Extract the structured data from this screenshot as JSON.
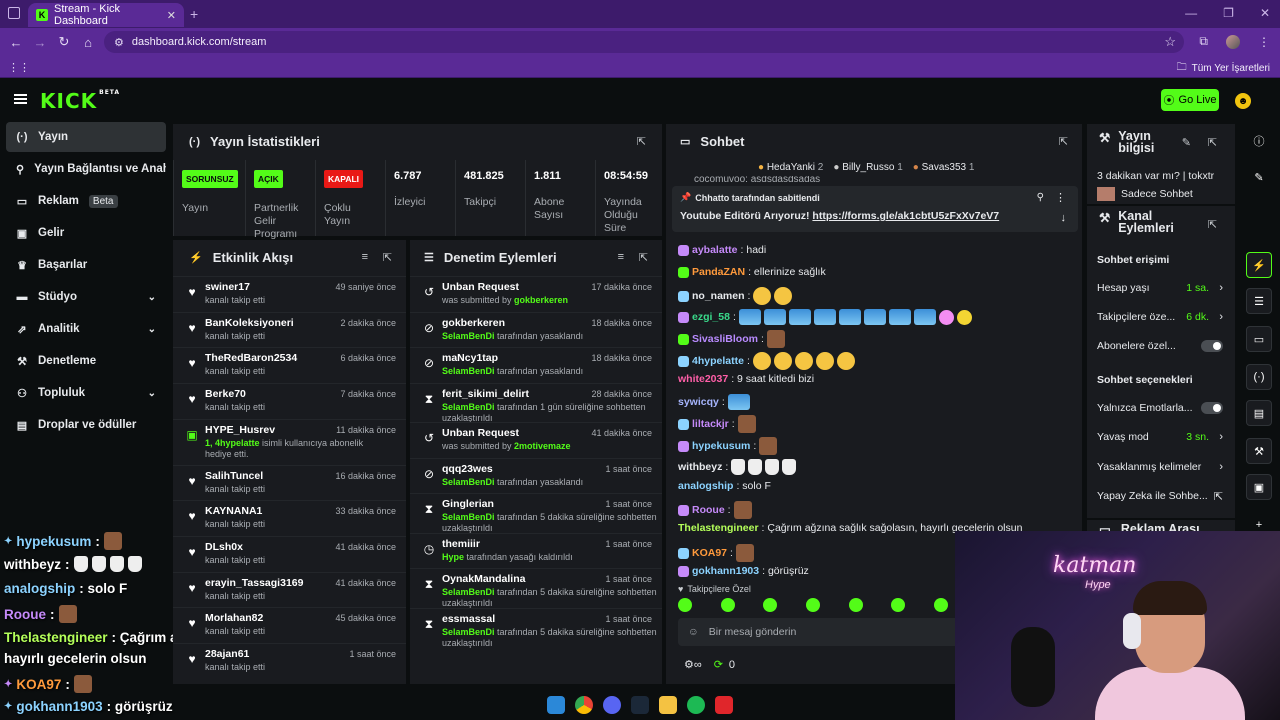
{
  "browser": {
    "tab_title": "Stream - Kick Dashboard",
    "tab_favicon": "K",
    "url": "dashboard.kick.com/stream",
    "bookmarks_label": "Tüm Yer İşaretleri"
  },
  "header": {
    "logo": "KICK",
    "logo_sup": "BETA",
    "go_live": "Go Live"
  },
  "sidebar": {
    "items": [
      {
        "label": "Yayın",
        "icon": "broadcast-icon"
      },
      {
        "label": "Yayın Bağlantısı ve Anahtar",
        "icon": "link-icon"
      },
      {
        "label": "Reklam",
        "icon": "ad-icon",
        "badge": "Beta"
      },
      {
        "label": "Gelir",
        "icon": "revenue-icon"
      },
      {
        "label": "Başarılar",
        "icon": "trophy-icon"
      },
      {
        "label": "Stüdyo",
        "icon": "studio-icon"
      },
      {
        "label": "Analitik",
        "icon": "analytics-icon"
      },
      {
        "label": "Denetleme",
        "icon": "moderation-icon"
      },
      {
        "label": "Topluluk",
        "icon": "community-icon"
      },
      {
        "label": "Droplar ve ödüller",
        "icon": "drops-icon"
      }
    ]
  },
  "stats": {
    "title": "Yayın İstatistikleri",
    "items": [
      {
        "badge": "SORUNSUZ",
        "label": "Yayın"
      },
      {
        "badge": "AÇIK",
        "label": "Partnerlik Gelir Programı"
      },
      {
        "badge": "KAPALI",
        "label": "Çoklu Yayın"
      },
      {
        "value": "6.787",
        "label": "İzleyici"
      },
      {
        "value": "481.825",
        "label": "Takipçi"
      },
      {
        "value": "1.811",
        "label": "Abone Sayısı"
      },
      {
        "value": "08:54:59",
        "label": "Yayında Olduğu Süre"
      }
    ]
  },
  "activity": {
    "title": "Etkinlik Akışı",
    "rows": [
      {
        "name": "swiner17",
        "sub": "kanalı takip etti",
        "time": "49 saniye önce"
      },
      {
        "name": "BanKoleksiyoneri",
        "sub": "kanalı takip etti",
        "time": "2 dakika önce"
      },
      {
        "name": "TheRedBaron2534",
        "sub": "kanalı takip etti",
        "time": "6 dakika önce"
      },
      {
        "name": "Berke70",
        "sub": "kanalı takip etti",
        "time": "7 dakika önce"
      },
      {
        "name": "HYPE_Husrev",
        "sub_green": "1, 4hypelatte",
        "sub": " isimli kullanıcıya abonelik hediye etti.",
        "time": "11 dakika önce"
      },
      {
        "name": "SalihTuncel",
        "sub": "kanalı takip etti",
        "time": "16 dakika önce"
      },
      {
        "name": "KAYNANA1",
        "sub": "kanalı takip etti",
        "time": "33 dakika önce"
      },
      {
        "name": "DLsh0x",
        "sub": "kanalı takip etti",
        "time": "41 dakika önce"
      },
      {
        "name": "erayin_Tassagi3169",
        "sub": "kanalı takip etti",
        "time": "41 dakika önce"
      },
      {
        "name": "Morlahan82",
        "sub": "kanalı takip etti",
        "time": "45 dakika önce"
      },
      {
        "name": "28ajan61",
        "sub": "kanalı takip etti",
        "time": "1 saat önce"
      }
    ]
  },
  "moderation": {
    "title": "Denetim Eylemleri",
    "rows": [
      {
        "name": "Unban Request",
        "pre": "was submitted by ",
        "who": "gokberkeren",
        "post": "",
        "time": "17 dakika önce"
      },
      {
        "name": "gokberkeren",
        "pre": "",
        "who": "SelamBenDi",
        "post": " tarafından yasaklandı",
        "time": "18 dakika önce"
      },
      {
        "name": "maNcy1tap",
        "pre": "",
        "who": "SelamBenDi",
        "post": " tarafından yasaklandı",
        "time": "18 dakika önce"
      },
      {
        "name": "ferit_sikimi_delirt",
        "pre": "",
        "who": "SelamBenDi",
        "post": " tarafından 1 gün süreliğine sohbetten",
        "post2": "uzaklaştırıldı",
        "time": "28 dakika önce"
      },
      {
        "name": "Unban Request",
        "pre": "was submitted by ",
        "who": "2motivemaze",
        "post": "",
        "time": "41 dakika önce"
      },
      {
        "name": "qqq23wes",
        "pre": "",
        "who": "SelamBenDi",
        "post": " tarafından yasaklandı",
        "time": "1 saat önce"
      },
      {
        "name": "Ginglerian",
        "pre": "",
        "who": "SelamBenDi",
        "post": " tarafından 5 dakika süreliğine sohbetten",
        "post2": "uzaklaştırıldı",
        "time": "1 saat önce"
      },
      {
        "name": "themiiir",
        "pre": "",
        "who": "Hype",
        "post": " tarafından yasağı kaldırıldı",
        "time": "1 saat önce"
      },
      {
        "name": "OynakMandalina",
        "pre": "",
        "who": "SelamBenDi",
        "post": " tarafından 5 dakika süreliğine sohbetten",
        "post2": "uzaklaştırıldı",
        "time": "1 saat önce"
      },
      {
        "name": "essmassal",
        "pre": "",
        "who": "SelamBenDi",
        "post": " tarafından 5 dakika süreliğine sohbetten",
        "post2": "uzaklaştırıldı",
        "time": "1 saat önce"
      }
    ]
  },
  "chat": {
    "title": "Sohbet",
    "top_gifters": [
      {
        "name": "HedaYanki",
        "count": "2"
      },
      {
        "name": "Billy_Russo",
        "count": "1"
      },
      {
        "name": "Savas353",
        "count": "1"
      }
    ],
    "scrolled_line": "cocomuvoo: asdsdasdsadas",
    "pinned_by": "Chhatto tarafından sabitlendi",
    "pinned_text": "Youtube Editörü Arıyoruz! ",
    "pinned_link": "https://forms.gle/ak1cbtU5zFxXv7eV7",
    "messages": [
      {
        "user": "aybalatte",
        "color": "#c58af9",
        "text": ": hadi"
      },
      {
        "user": "PandaZAN",
        "color": "#ff9a3c",
        "text": ": ellerinize sağlık"
      },
      {
        "user": "no_namen",
        "color": "#e8eaed",
        "text": ": "
      },
      {
        "user": "ezgi_58",
        "color": "#39d98a",
        "text": ": "
      },
      {
        "user": "SivasliBloom",
        "color": "#b98bff",
        "text": ": "
      },
      {
        "user": "4hypelatte",
        "color": "#8cd3ff",
        "text": ": "
      },
      {
        "user": "white2037",
        "color": "#ff5fa8",
        "text": ": 9 saat kitledi bizi"
      },
      {
        "user": "sywicqy",
        "color": "#a5b4fc",
        "text": ": "
      },
      {
        "user": "liltackjr",
        "color": "#c58af9",
        "text": ": "
      },
      {
        "user": "hypekusum",
        "color": "#8cd3ff",
        "text": ": "
      },
      {
        "user": "withbeyz",
        "color": "#e8eaed",
        "text": ": "
      },
      {
        "user": "analogship",
        "color": "#8cd3ff",
        "text": ": solo F"
      },
      {
        "user": "Rooue",
        "color": "#c58af9",
        "text": ": "
      },
      {
        "user": "Thelastengineer",
        "color": "#b4ff5a",
        "text": ": Çağrım ağzına sağlık sağolasın, hayırlı gecelerin olsun"
      },
      {
        "user": "KOA97",
        "color": "#ff9a3c",
        "text": ": "
      },
      {
        "user": "gokhann1903",
        "color": "#8cd3ff",
        "text": ": görüşrüz"
      }
    ],
    "followers_only": "Takipçilere Özel",
    "input_placeholder": "Bir mesaj gönderin",
    "points": "0"
  },
  "stream_info": {
    "title": "Yayın bilgisi",
    "stream_title": "3 dakikan var mı? | tokxtr",
    "category": "Sadece Sohbet"
  },
  "channel_actions": {
    "title": "Kanal Eylemleri",
    "chat_access": "Sohbet erişimi",
    "rows1": [
      {
        "label": "Hesap yaşı",
        "value": "1 sa."
      },
      {
        "label": "Takipçilere öze...",
        "value": "6 dk."
      },
      {
        "label": "Abonelere özel...",
        "toggle": true
      }
    ],
    "chat_options": "Sohbet seçenekleri",
    "rows2": [
      {
        "label": "Yalnızca Emotlarla...",
        "toggle": true
      },
      {
        "label": "Yavaş mod",
        "value": "3 sn."
      },
      {
        "label": "Yasaklanmış kelimeler"
      },
      {
        "label": "Yapay Zeka ile Sohbe..."
      }
    ],
    "ad_break": "Reklam Arası"
  },
  "overlay_chat": [
    {
      "user": "hypekusum",
      "color": "#8cd3ff",
      "text": " :"
    },
    {
      "user": "withbeyz",
      "color": "#fff",
      "text": " :"
    },
    {
      "user": "analogship",
      "color": "#8cd3ff",
      "text": " : solo F"
    },
    {
      "user": "Rooue",
      "color": "#c58af9",
      "text": " :"
    },
    {
      "user": "Thelastengineer",
      "color": "#b4ff5a",
      "text": " : Çağrım ağzına sağlık sağolasın,"
    },
    {
      "user": "",
      "color": "#fff",
      "text": "hayırlı gecelerin olsun"
    },
    {
      "user": "KOA97",
      "color": "#ff9a3c",
      "text": " :"
    },
    {
      "user": "gokhann1903",
      "color": "#8cd3ff",
      "text": " : görüşrüz"
    }
  ],
  "webcam": {
    "neon": "katman",
    "neon2": "Hype"
  }
}
